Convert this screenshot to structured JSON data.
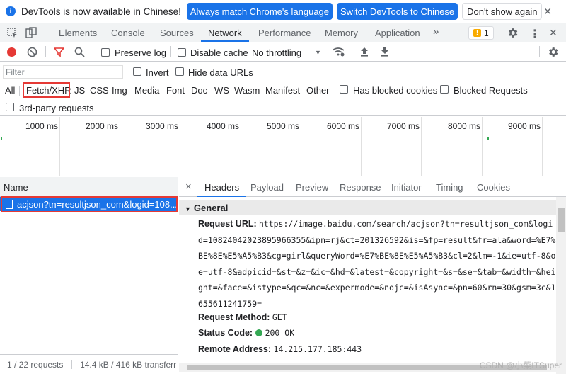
{
  "infobar": {
    "message": "DevTools is now available in Chinese!",
    "always_match": "Always match Chrome's language",
    "switch": "Switch DevTools to Chinese",
    "dont_show": "Don't show again"
  },
  "tabs": [
    "Elements",
    "Console",
    "Sources",
    "Network",
    "Performance",
    "Memory",
    "Application"
  ],
  "tabs_more": "»",
  "issues_count": "1",
  "toolbar": {
    "preserve_log": "Preserve log",
    "disable_cache": "Disable cache",
    "throttling": "No throttling"
  },
  "filter": {
    "placeholder": "Filter",
    "invert": "Invert",
    "hide_data_urls": "Hide data URLs"
  },
  "types": [
    "All",
    "Fetch/XHR",
    "JS",
    "CSS",
    "Img",
    "Media",
    "Font",
    "Doc",
    "WS",
    "Wasm",
    "Manifest",
    "Other"
  ],
  "has_blocked_cookies": "Has blocked cookies",
  "blocked_requests": "Blocked Requests",
  "third_party": "3rd-party requests",
  "timeline_ticks": [
    "1000 ms",
    "2000 ms",
    "3000 ms",
    "4000 ms",
    "5000 ms",
    "6000 ms",
    "7000 ms",
    "8000 ms",
    "9000 ms"
  ],
  "requests": {
    "header": "Name",
    "selected": "acjson?tn=resultjson_com&logid=108...",
    "status": "1 / 22 requests",
    "transfer": "14.4 kB / 416 kB transferr"
  },
  "details": {
    "close": "×",
    "tabs": [
      "Headers",
      "Payload",
      "Preview",
      "Response",
      "Initiator",
      "Timing",
      "Cookies"
    ],
    "section": "General",
    "request_url_label": "Request URL:",
    "request_url": "https://image.baidu.com/search/acjson?tn=resultjson_com&logid=10824042023895966355&ipn=rj&ct=201326592&is=&fp=result&fr=ala&word=%E7%BE%8E%E5%A5%B3&cg=girl&queryWord=%E7%BE%8E%E5%A5%B3&cl=2&lm=-1&ie=utf-8&oe=utf-8&adpicid=&st=&z=&ic=&hd=&latest=&copyright=&s=&se=&tab=&width=&height=&face=&istype=&qc=&nc=&expermode=&nojc=&isAsync=&pn=60&rn=30&gsm=3c&1655611241759=",
    "method_label": "Request Method:",
    "method": "GET",
    "status_label": "Status Code:",
    "status": "200 OK",
    "remote_label": "Remote Address:",
    "remote": "14.215.177.185:443"
  },
  "watermark": "CSDN @小菜ITSuper",
  "colors": {
    "accent": "#1a73e8",
    "highlight": "#e53935",
    "ok": "#34a853"
  }
}
